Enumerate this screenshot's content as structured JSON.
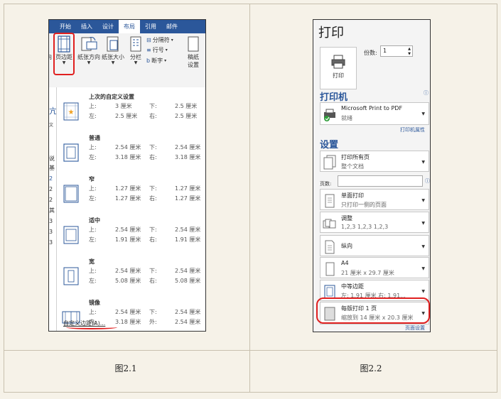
{
  "fig1": {
    "tabs": [
      "开始",
      "插入",
      "设计",
      "布局",
      "引用",
      "邮件"
    ],
    "active_tab_index": 3,
    "ribbon": {
      "margins": "页边距",
      "orientation": "纸张方向",
      "size": "纸张大小",
      "columns": "分栏",
      "breaks": "分隔符",
      "line_numbers": "行号",
      "hyphenation": "断字",
      "draft_settings_1": "稿纸",
      "draft_settings_2": "设置"
    },
    "margin_options": [
      {
        "name": "上次的自定义设置",
        "l1a": "上:",
        "v1a": "3 厘米",
        "l1b": "下:",
        "v1b": "2.5 厘米",
        "l2a": "左:",
        "v2a": "2.5 厘米",
        "l2b": "右:",
        "v2b": "2.5 厘米"
      },
      {
        "name": "普通",
        "l1a": "上:",
        "v1a": "2.54 厘米",
        "l1b": "下:",
        "v1b": "2.54 厘米",
        "l2a": "左:",
        "v2a": "3.18 厘米",
        "l2b": "右:",
        "v2b": "3.18 厘米"
      },
      {
        "name": "窄",
        "l1a": "上:",
        "v1a": "1.27 厘米",
        "l1b": "下:",
        "v1b": "1.27 厘米",
        "l2a": "左:",
        "v2a": "1.27 厘米",
        "l2b": "右:",
        "v2b": "1.27 厘米"
      },
      {
        "name": "适中",
        "l1a": "上:",
        "v1a": "2.54 厘米",
        "l1b": "下:",
        "v1b": "2.54 厘米",
        "l2a": "左:",
        "v2a": "1.91 厘米",
        "l2b": "右:",
        "v2b": "1.91 厘米"
      },
      {
        "name": "宽",
        "l1a": "上:",
        "v1a": "2.54 厘米",
        "l1b": "下:",
        "v1b": "2.54 厘米",
        "l2a": "左:",
        "v2a": "5.08 厘米",
        "l2b": "右:",
        "v2b": "5.08 厘米"
      },
      {
        "name": "镜像",
        "l1a": "上:",
        "v1a": "2.54 厘米",
        "l1b": "下:",
        "v1b": "2.54 厘米",
        "l2a": "内:",
        "v2a": "3.18 厘米",
        "l2b": "外:",
        "v2b": "2.54 厘米"
      }
    ],
    "custom_margins": "自定义边距(A)...",
    "left_strip": [
      "向",
      "亢",
      "文",
      "说",
      "基",
      "2",
      "2",
      "2",
      "其",
      "3",
      "3",
      "3"
    ],
    "caption": "图2.1"
  },
  "fig2": {
    "title": "打印",
    "print_button": "打印",
    "copies_label": "份数:",
    "copies_value": "1",
    "printer_section": "打印机",
    "printer_name": "Microsoft Print to PDF",
    "printer_status": "就绪",
    "printer_props": "打印机属性",
    "settings_section": "设置",
    "pages_label": "页数:",
    "settings": [
      {
        "main": "打印所有页",
        "sub": "整个文档"
      },
      {
        "main": "单面打印",
        "sub": "只打印一侧的页面"
      },
      {
        "main": "调整",
        "sub": "1,2,3    1,2,3    1,2,3"
      },
      {
        "main": "纵向",
        "sub": ""
      },
      {
        "main": "A4",
        "sub": "21 厘米 x 29.7 厘米"
      },
      {
        "main": "中等边距",
        "sub": "左: 1.91 厘米    右: 1.91..."
      },
      {
        "main": "每版打印 1 页",
        "sub": "缩放到 14 厘米 x 20.3 厘米"
      }
    ],
    "page_setup": "页面设置",
    "caption": "图2.2"
  },
  "colors": {
    "accent": "#2b579a",
    "highlight": "#e02020",
    "background": "#f6f2e8"
  }
}
